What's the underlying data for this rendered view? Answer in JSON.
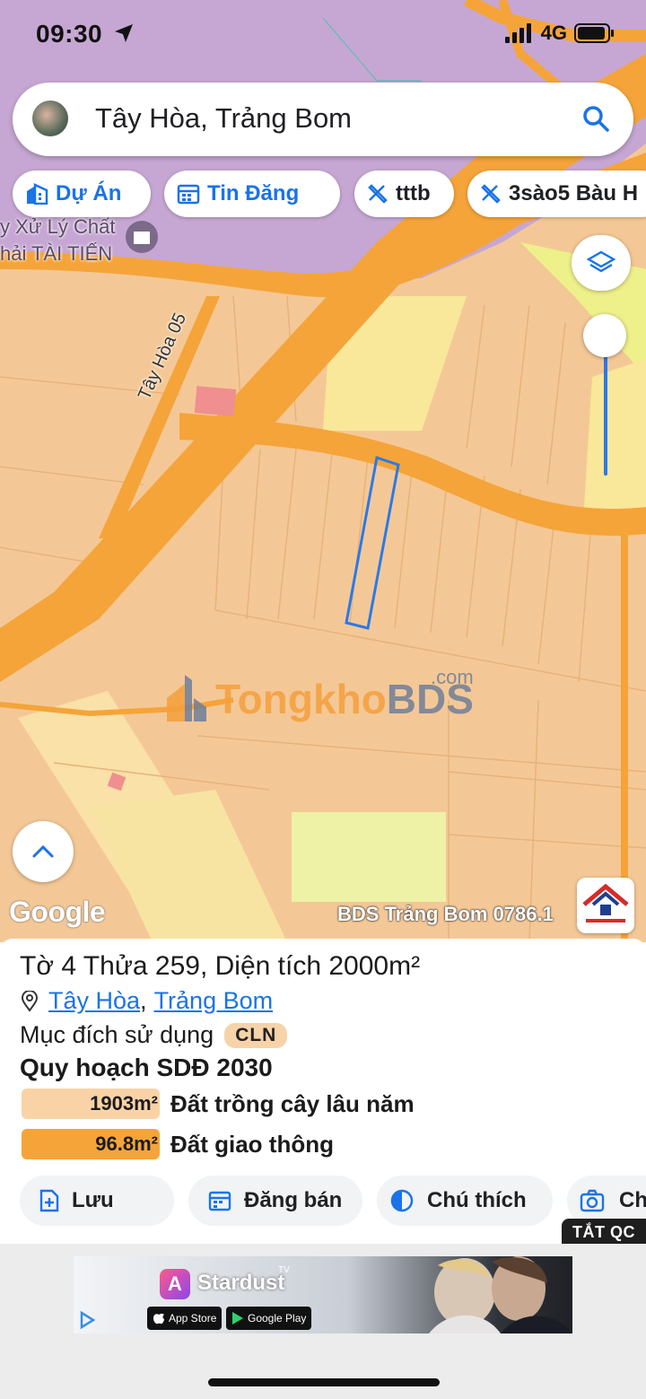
{
  "status": {
    "time": "09:30",
    "network": "4G"
  },
  "search": {
    "query": "Tây Hòa, Trảng Bom"
  },
  "chips": [
    {
      "label": "Dự Án",
      "icon": "building-icon"
    },
    {
      "label": "Tin Đăng",
      "icon": "listing-icon"
    },
    {
      "label": "tttb",
      "icon": "ruler-icon"
    },
    {
      "label": "3sào5 Bàu H",
      "icon": "ruler-icon"
    }
  ],
  "map": {
    "poi_label_line1": "y Xử Lý Chất",
    "poi_label_line2": "hải TÀI TIẾN",
    "road_label": "Tây Hòa 05",
    "google": "Google",
    "watermark_left": "Tongkho",
    "watermark_right": "BDS",
    "watermark_suffix": ".com",
    "credit": "BDS Trảng Bom 0786.1",
    "colors": {
      "land": "#f4c896",
      "road": "#f5a43a",
      "industrial": "#c6a7d3",
      "parcel_outline": "#2a7ae8",
      "perennial": "#f9e79a"
    }
  },
  "panel": {
    "title": "Tờ 4 Thửa 259, Diện tích 2000m²",
    "location_ward": "Tây Hòa",
    "location_separator": ",",
    "location_district": "Trảng Bom",
    "purpose_label": "Mục đích sử dụng",
    "purpose_code": "CLN",
    "plan_title": "Quy hoạch SDĐ 2030",
    "plan_rows": [
      {
        "area": "1903m²",
        "label": "Đất trồng cây lâu năm",
        "color": "#f9d3a6"
      },
      {
        "area": "96.8m²",
        "label": "Đất giao thông",
        "color": "#f5a43a"
      }
    ],
    "actions": [
      {
        "label": "Lưu",
        "icon": "save-file-icon"
      },
      {
        "label": "Đăng bán",
        "icon": "calendar-icon"
      },
      {
        "label": "Chú thích",
        "icon": "legend-icon"
      },
      {
        "label": "Ch",
        "icon": "camera-icon"
      }
    ],
    "ad_close": "TẮT QC"
  },
  "ad": {
    "app_name": "Stardust",
    "tm": "TV",
    "app_store": "App Store",
    "google_play": "Google Play"
  }
}
